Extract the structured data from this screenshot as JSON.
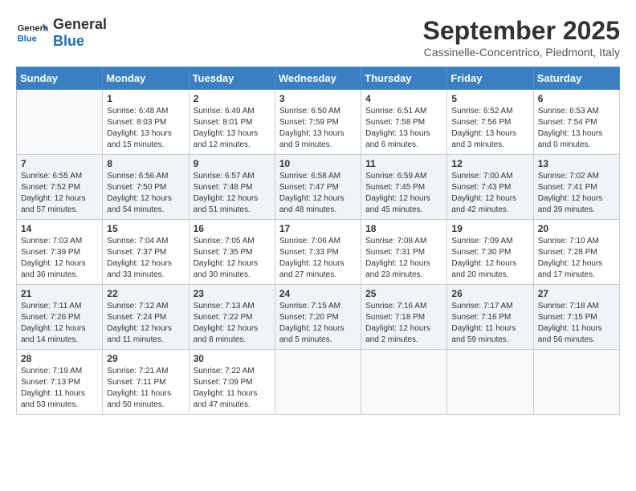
{
  "header": {
    "logo_general": "General",
    "logo_blue": "Blue",
    "month_title": "September 2025",
    "location": "Cassinelle-Concentrico, Piedmont, Italy"
  },
  "columns": [
    "Sunday",
    "Monday",
    "Tuesday",
    "Wednesday",
    "Thursday",
    "Friday",
    "Saturday"
  ],
  "weeks": [
    [
      {
        "day": "",
        "info": ""
      },
      {
        "day": "1",
        "info": "Sunrise: 6:48 AM\nSunset: 8:03 PM\nDaylight: 13 hours\nand 15 minutes."
      },
      {
        "day": "2",
        "info": "Sunrise: 6:49 AM\nSunset: 8:01 PM\nDaylight: 13 hours\nand 12 minutes."
      },
      {
        "day": "3",
        "info": "Sunrise: 6:50 AM\nSunset: 7:59 PM\nDaylight: 13 hours\nand 9 minutes."
      },
      {
        "day": "4",
        "info": "Sunrise: 6:51 AM\nSunset: 7:58 PM\nDaylight: 13 hours\nand 6 minutes."
      },
      {
        "day": "5",
        "info": "Sunrise: 6:52 AM\nSunset: 7:56 PM\nDaylight: 13 hours\nand 3 minutes."
      },
      {
        "day": "6",
        "info": "Sunrise: 6:53 AM\nSunset: 7:54 PM\nDaylight: 13 hours\nand 0 minutes."
      }
    ],
    [
      {
        "day": "7",
        "info": "Sunrise: 6:55 AM\nSunset: 7:52 PM\nDaylight: 12 hours\nand 57 minutes."
      },
      {
        "day": "8",
        "info": "Sunrise: 6:56 AM\nSunset: 7:50 PM\nDaylight: 12 hours\nand 54 minutes."
      },
      {
        "day": "9",
        "info": "Sunrise: 6:57 AM\nSunset: 7:48 PM\nDaylight: 12 hours\nand 51 minutes."
      },
      {
        "day": "10",
        "info": "Sunrise: 6:58 AM\nSunset: 7:47 PM\nDaylight: 12 hours\nand 48 minutes."
      },
      {
        "day": "11",
        "info": "Sunrise: 6:59 AM\nSunset: 7:45 PM\nDaylight: 12 hours\nand 45 minutes."
      },
      {
        "day": "12",
        "info": "Sunrise: 7:00 AM\nSunset: 7:43 PM\nDaylight: 12 hours\nand 42 minutes."
      },
      {
        "day": "13",
        "info": "Sunrise: 7:02 AM\nSunset: 7:41 PM\nDaylight: 12 hours\nand 39 minutes."
      }
    ],
    [
      {
        "day": "14",
        "info": "Sunrise: 7:03 AM\nSunset: 7:39 PM\nDaylight: 12 hours\nand 36 minutes."
      },
      {
        "day": "15",
        "info": "Sunrise: 7:04 AM\nSunset: 7:37 PM\nDaylight: 12 hours\nand 33 minutes."
      },
      {
        "day": "16",
        "info": "Sunrise: 7:05 AM\nSunset: 7:35 PM\nDaylight: 12 hours\nand 30 minutes."
      },
      {
        "day": "17",
        "info": "Sunrise: 7:06 AM\nSunset: 7:33 PM\nDaylight: 12 hours\nand 27 minutes."
      },
      {
        "day": "18",
        "info": "Sunrise: 7:08 AM\nSunset: 7:31 PM\nDaylight: 12 hours\nand 23 minutes."
      },
      {
        "day": "19",
        "info": "Sunrise: 7:09 AM\nSunset: 7:30 PM\nDaylight: 12 hours\nand 20 minutes."
      },
      {
        "day": "20",
        "info": "Sunrise: 7:10 AM\nSunset: 7:28 PM\nDaylight: 12 hours\nand 17 minutes."
      }
    ],
    [
      {
        "day": "21",
        "info": "Sunrise: 7:11 AM\nSunset: 7:26 PM\nDaylight: 12 hours\nand 14 minutes."
      },
      {
        "day": "22",
        "info": "Sunrise: 7:12 AM\nSunset: 7:24 PM\nDaylight: 12 hours\nand 11 minutes."
      },
      {
        "day": "23",
        "info": "Sunrise: 7:13 AM\nSunset: 7:22 PM\nDaylight: 12 hours\nand 8 minutes."
      },
      {
        "day": "24",
        "info": "Sunrise: 7:15 AM\nSunset: 7:20 PM\nDaylight: 12 hours\nand 5 minutes."
      },
      {
        "day": "25",
        "info": "Sunrise: 7:16 AM\nSunset: 7:18 PM\nDaylight: 12 hours\nand 2 minutes."
      },
      {
        "day": "26",
        "info": "Sunrise: 7:17 AM\nSunset: 7:16 PM\nDaylight: 11 hours\nand 59 minutes."
      },
      {
        "day": "27",
        "info": "Sunrise: 7:18 AM\nSunset: 7:15 PM\nDaylight: 11 hours\nand 56 minutes."
      }
    ],
    [
      {
        "day": "28",
        "info": "Sunrise: 7:19 AM\nSunset: 7:13 PM\nDaylight: 11 hours\nand 53 minutes."
      },
      {
        "day": "29",
        "info": "Sunrise: 7:21 AM\nSunset: 7:11 PM\nDaylight: 11 hours\nand 50 minutes."
      },
      {
        "day": "30",
        "info": "Sunrise: 7:22 AM\nSunset: 7:09 PM\nDaylight: 11 hours\nand 47 minutes."
      },
      {
        "day": "",
        "info": ""
      },
      {
        "day": "",
        "info": ""
      },
      {
        "day": "",
        "info": ""
      },
      {
        "day": "",
        "info": ""
      }
    ]
  ]
}
